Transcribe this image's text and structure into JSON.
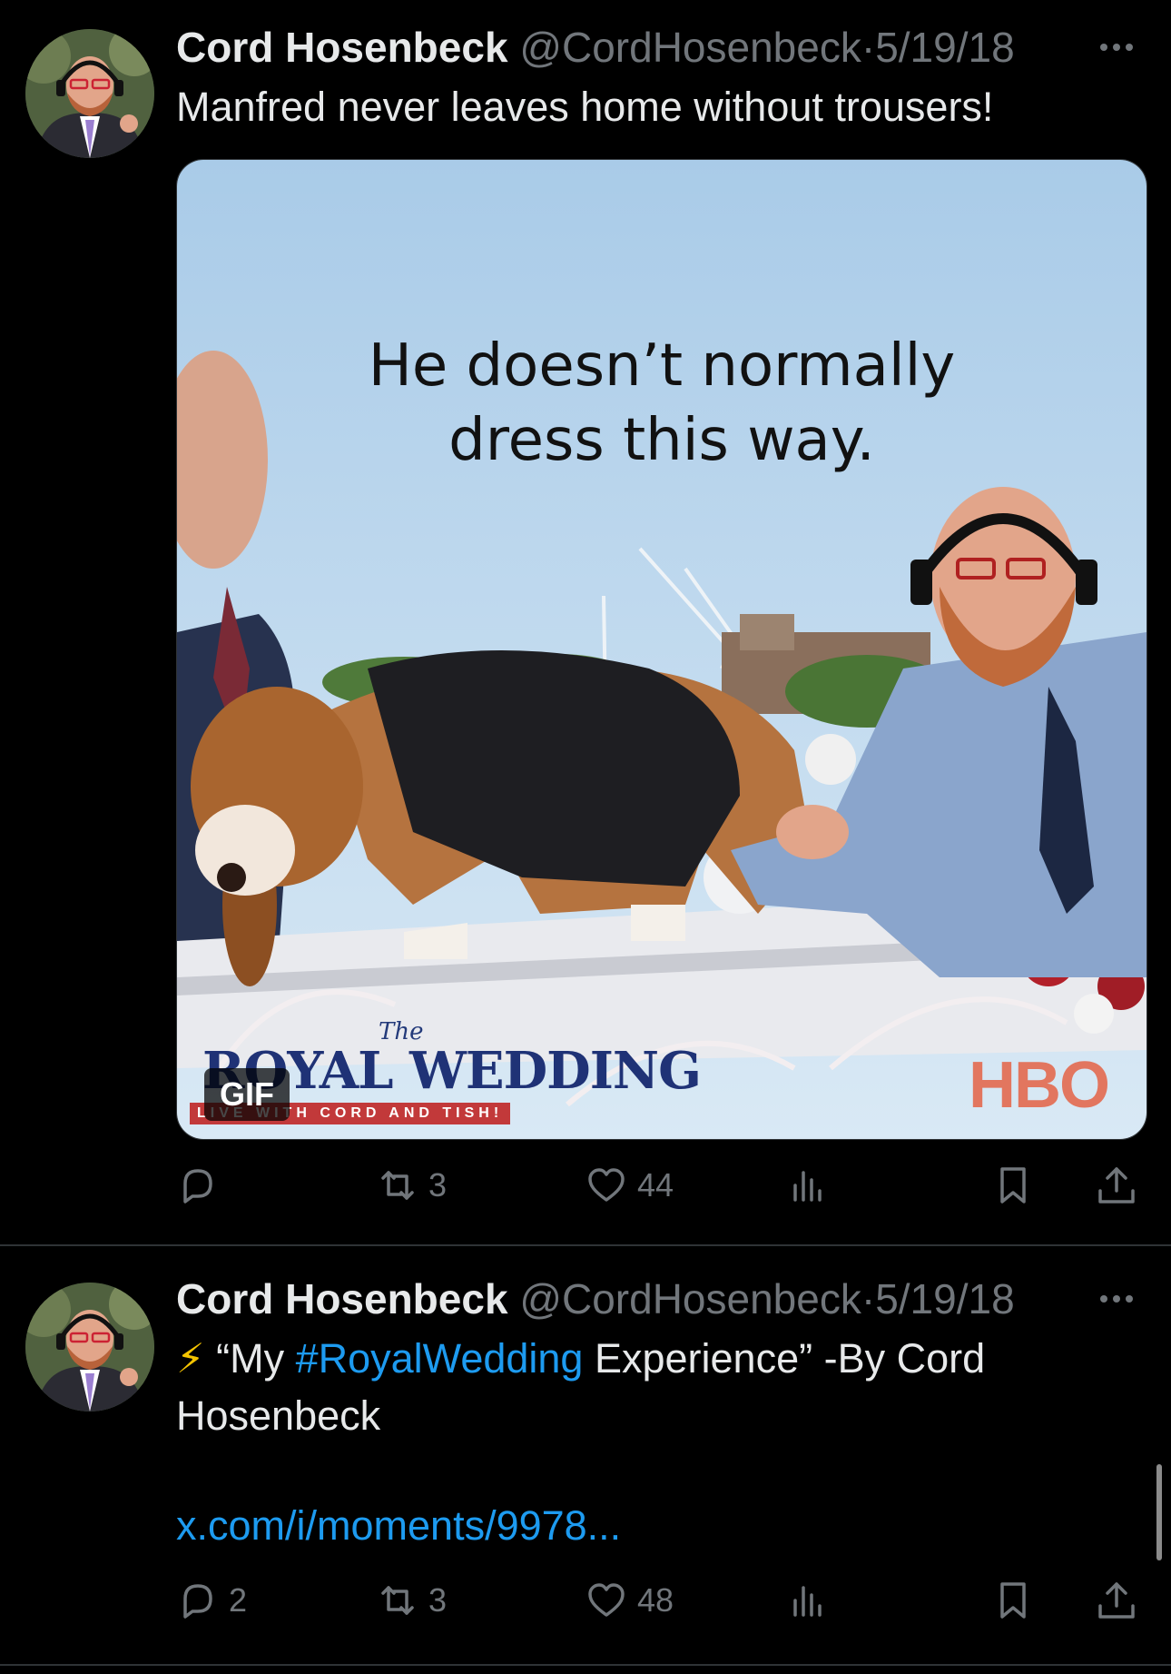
{
  "tweets": [
    {
      "author_name": "Cord Hosenbeck",
      "handle": "@CordHosenbeck",
      "separator": "·",
      "date": "5/19/18",
      "text": "Manfred never leaves home without trousers!",
      "media": {
        "badge": "GIF",
        "caption_line1": "He doesn’t normally",
        "caption_line2": "dress this way.",
        "overlay_script": "The",
        "overlay_title": "ROYAL WEDDING",
        "overlay_subtitle": "LIVE WITH CORD AND TISH!",
        "overlay_network": "HBO"
      },
      "stats": {
        "replies": "",
        "reposts": "3",
        "likes": "44"
      }
    },
    {
      "author_name": "Cord Hosenbeck",
      "handle": "@CordHosenbeck",
      "separator": "·",
      "date": "5/19/18",
      "text_emoji": "⚡",
      "text_open": " “My ",
      "text_hashtag": "#RoyalWedding",
      "text_rest": " Experience” -By Cord",
      "text_line2": "Hosenbeck",
      "link": "x.com/i/moments/9978...",
      "stats": {
        "replies": "2",
        "reposts": "3",
        "likes": "48"
      }
    }
  ],
  "colors": {
    "background": "#000000",
    "text_primary": "#e7e9ea",
    "text_secondary": "#71767b",
    "accent_link": "#1d9bf0",
    "divider": "#2f3336"
  },
  "icons": [
    "more-icon",
    "reply-icon",
    "repost-icon",
    "like-icon",
    "views-icon",
    "bookmark-icon",
    "share-icon"
  ]
}
